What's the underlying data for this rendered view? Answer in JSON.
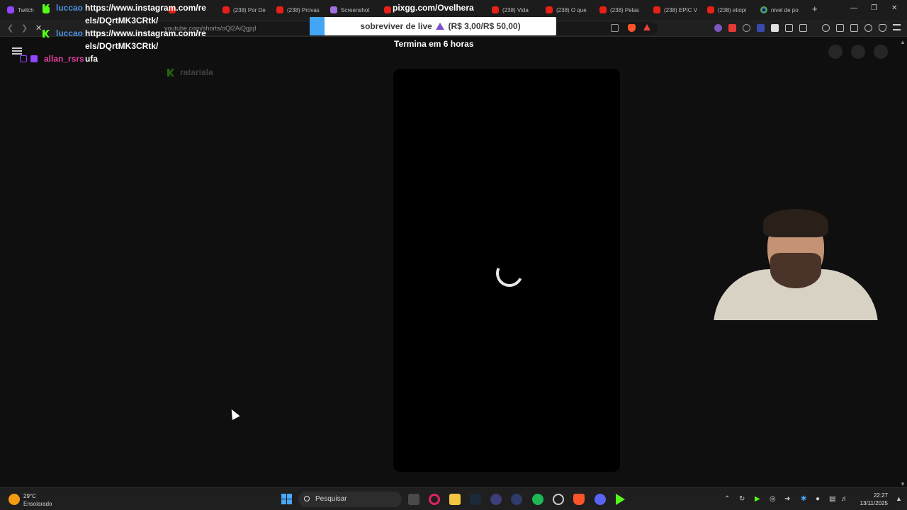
{
  "browser": {
    "tabs": [
      {
        "label": "Twitch",
        "favicon": "twitch-icon"
      },
      {
        "label": "",
        "favicon": "kick-icon"
      },
      {
        "label": "",
        "favicon": "youtube-icon"
      },
      {
        "label": "(238) Por De",
        "favicon": "youtube-icon"
      },
      {
        "label": "(238) Provas",
        "favicon": "youtube-icon"
      },
      {
        "label": "Screenshot",
        "favicon": "pen-icon"
      },
      {
        "label": "",
        "favicon": "youtube-icon"
      },
      {
        "label": "(238) Vida",
        "favicon": "youtube-icon"
      },
      {
        "label": "(238) O que",
        "favicon": "youtube-icon"
      },
      {
        "label": "(238) Pelas",
        "favicon": "youtube-icon"
      },
      {
        "label": "(238) EPIC V",
        "favicon": "youtube-icon"
      },
      {
        "label": "(238) etiopi",
        "favicon": "youtube-icon"
      },
      {
        "label": "nivel de po",
        "favicon": "google-icon"
      }
    ],
    "url": "youtube.com/shorts/oQl2AiQgjqI"
  },
  "overlay": {
    "pixgg": "pixgg.com/Ovelhera",
    "alert_text": "sobreviver de live",
    "alert_amount": "(R$ 3,00/R$ 50,00)",
    "ends": "Termina em 6 horas",
    "accent_color": "#42a5f5"
  },
  "chat": [
    {
      "user": "luccao",
      "message": "https://www.instagram.com/reels/DQrtMK3CRtk/"
    },
    {
      "user": "luccao",
      "message": "https://www.instagram.com/reels/DQrtMK3CRtk/"
    },
    {
      "user": "allan_rsrs",
      "message": "ufa"
    },
    {
      "user": "ratariala",
      "message": ""
    }
  ],
  "taskbar": {
    "weather_temp": "29°C",
    "weather_desc": "Ensolarado",
    "search_placeholder": "Pesquisar",
    "time": "22:27",
    "date": "13/11/2025"
  }
}
